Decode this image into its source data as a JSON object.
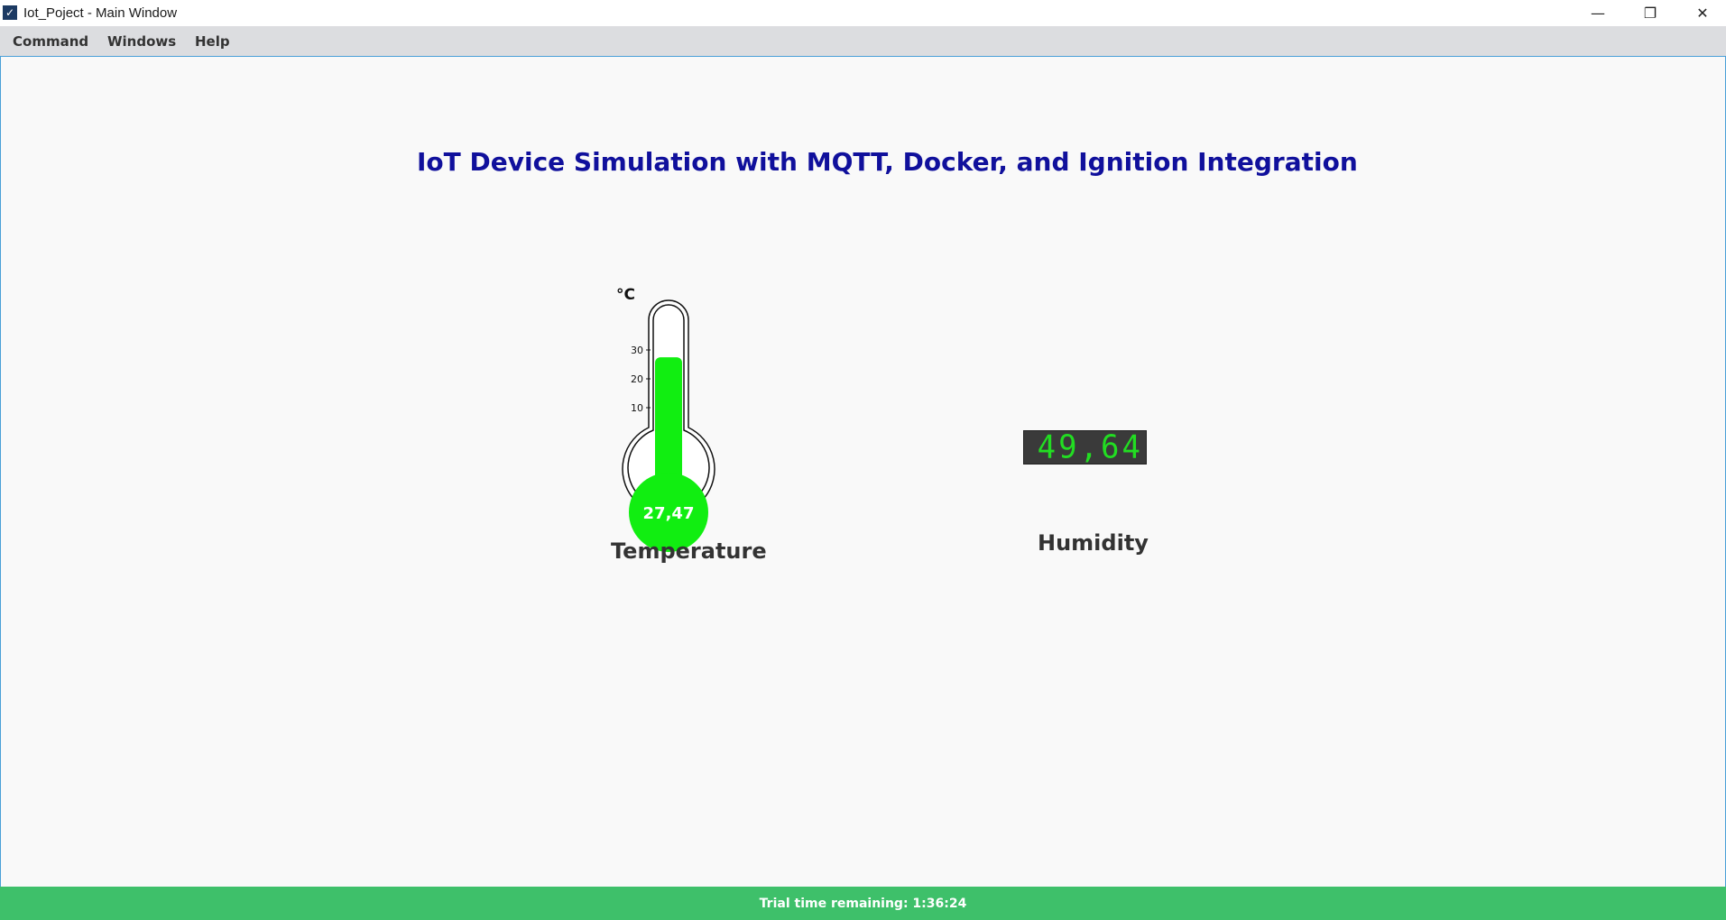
{
  "window": {
    "title": "Iot_Poject - Main Window",
    "app_icon": "check-icon",
    "minimize_glyph": "—",
    "restore_glyph": "❐",
    "close_glyph": "✕"
  },
  "menu": {
    "items": [
      {
        "label": "Command"
      },
      {
        "label": "Windows"
      },
      {
        "label": "Help"
      }
    ]
  },
  "main": {
    "title": "IoT Device Simulation with MQTT, Docker, and Ignition Integration",
    "temperature": {
      "unit": "°C",
      "value_text": "27,47",
      "value": 27.47,
      "scale_ticks": [
        "10",
        "20",
        "30"
      ],
      "fill_color": "#11ee11",
      "label": "Temperature"
    },
    "humidity": {
      "value_text": "49,64",
      "value": 49.64,
      "display_color": "#22dd22",
      "label": "Humidity"
    }
  },
  "status": {
    "text": "Trial time remaining: 1:36:24",
    "color": "#3ec06a"
  }
}
